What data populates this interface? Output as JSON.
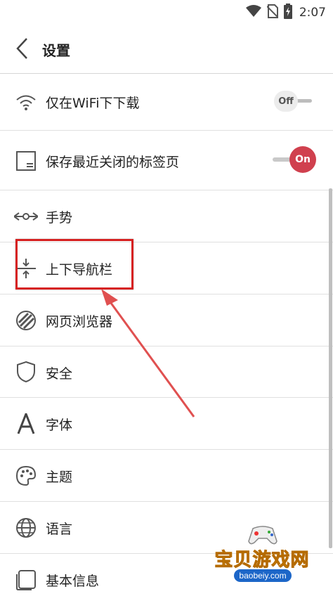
{
  "status_bar": {
    "time": "2:07",
    "icons": [
      "wifi-icon",
      "no-sim-icon",
      "battery-charging-icon"
    ]
  },
  "header": {
    "title": "设置",
    "back_icon": "chevron-left-icon"
  },
  "settings": {
    "wifi_download": {
      "label": "仅在WiFi下下载",
      "icon": "wifi-icon",
      "toggle_label": "Off",
      "enabled": false
    },
    "save_tabs": {
      "label": "保存最近关闭的标签页",
      "icon": "tab-page-icon",
      "toggle_label": "On",
      "enabled": true
    },
    "gestures": {
      "label": "手势",
      "icon": "gesture-icon"
    },
    "nav_bars": {
      "label": "上下导航栏",
      "icon": "compress-vertical-icon"
    },
    "web_browsing": {
      "label": "网页浏览器",
      "icon": "globe-stripes-icon"
    },
    "security": {
      "label": "安全",
      "icon": "shield-icon"
    },
    "font": {
      "label": "字体",
      "icon": "font-a-icon"
    },
    "theme": {
      "label": "主题",
      "icon": "palette-icon"
    },
    "language": {
      "label": "语言",
      "icon": "globe-icon"
    },
    "basic_info": {
      "label": "基本信息",
      "icon": "info-square-icon"
    }
  },
  "watermark": {
    "text": "宝贝游戏网",
    "url": "baobeiy.com"
  },
  "colors": {
    "toggle_on": "#d0404e",
    "highlight": "#d62020",
    "watermark": "#ffb400"
  }
}
